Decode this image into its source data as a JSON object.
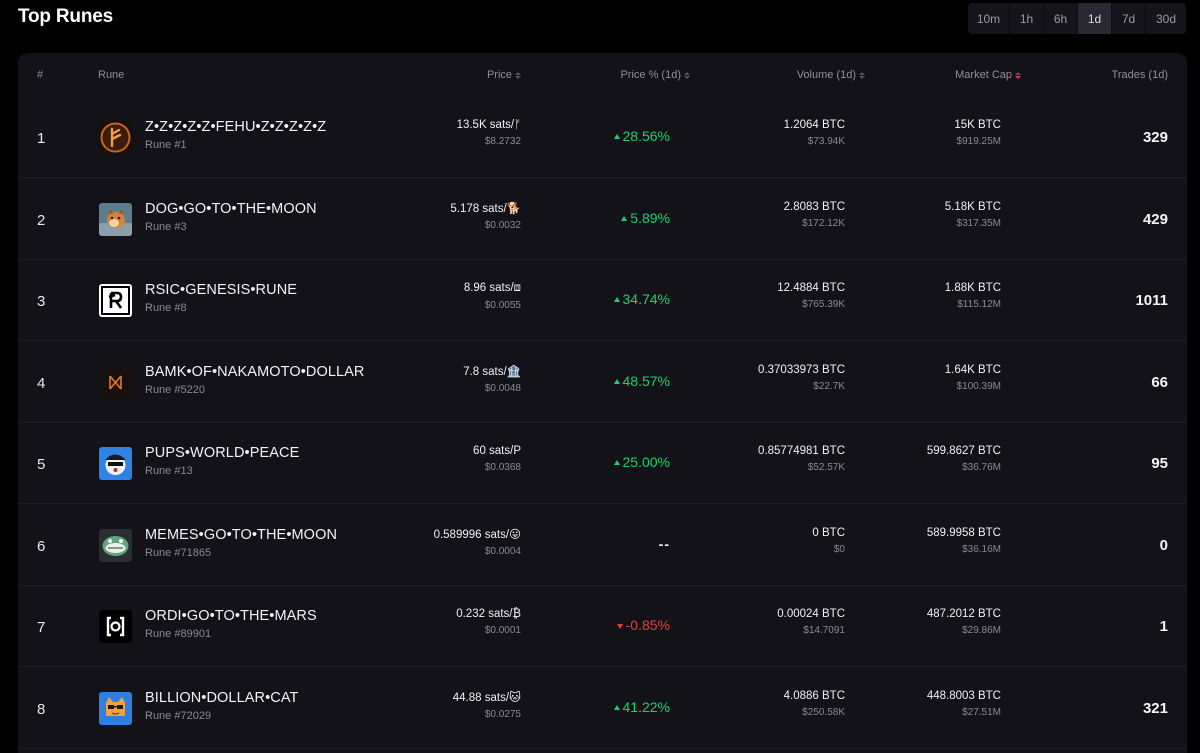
{
  "header": {
    "title": "Top Runes",
    "periods": [
      "10m",
      "1h",
      "6h",
      "1d",
      "7d",
      "30d"
    ],
    "active_period": "1d"
  },
  "columns": {
    "rank": "#",
    "rune": "Rune",
    "price": "Price",
    "price_pct": "Price % (1d)",
    "volume": "Volume (1d)",
    "market_cap": "Market Cap",
    "trades": "Trades (1d)"
  },
  "colors": {
    "positive": "#1fcf67",
    "negative": "#f03a3a",
    "sort_active": "#ff2a5c"
  },
  "rows": [
    {
      "rank": "1",
      "icon": "fehu-rune-icon",
      "name": "Z•Z•Z•Z•Z•FEHU•Z•Z•Z•Z•Z",
      "number": "Rune #1",
      "price_sats": "13.5K sats/ᚠ",
      "price_usd": "$8.2732",
      "pct": "28.56%",
      "dir": "up",
      "volume_btc": "1.2064 BTC",
      "volume_usd": "$73.94K",
      "cap_btc": "15K BTC",
      "cap_usd": "$919.25M",
      "trades": "329"
    },
    {
      "rank": "2",
      "icon": "dog-icon",
      "name": "DOG•GO•TO•THE•MOON",
      "number": "Rune #3",
      "price_sats": "5.178 sats/🐕",
      "price_usd": "$0.0032",
      "pct": "5.89%",
      "dir": "up",
      "volume_btc": "2.8083 BTC",
      "volume_usd": "$172.12K",
      "cap_btc": "5.18K BTC",
      "cap_usd": "$317.35M",
      "trades": "429"
    },
    {
      "rank": "3",
      "icon": "rsic-icon",
      "name": "RSIC•GENESIS•RUNE",
      "number": "Rune #8",
      "price_sats": "8.96 sats/⧈",
      "price_usd": "$0.0055",
      "pct": "34.74%",
      "dir": "up",
      "volume_btc": "12.4884 BTC",
      "volume_usd": "$765.39K",
      "cap_btc": "1.88K BTC",
      "cap_usd": "$115.12M",
      "trades": "1011"
    },
    {
      "rank": "4",
      "icon": "bamk-icon",
      "name": "BAMK•OF•NAKAMOTO•DOLLAR",
      "number": "Rune #5220",
      "price_sats": "7.8 sats/🏦",
      "price_usd": "$0.0048",
      "pct": "48.57%",
      "dir": "up",
      "volume_btc": "0.37033973 BTC",
      "volume_usd": "$22.7K",
      "cap_btc": "1.64K BTC",
      "cap_usd": "$100.39M",
      "trades": "66"
    },
    {
      "rank": "5",
      "icon": "pups-icon",
      "name": "PUPS•WORLD•PEACE",
      "number": "Rune #13",
      "price_sats": "60 sats/P",
      "price_usd": "$0.0368",
      "pct": "25.00%",
      "dir": "up",
      "volume_btc": "0.85774981 BTC",
      "volume_usd": "$52.57K",
      "cap_btc": "599.8627 BTC",
      "cap_usd": "$36.76M",
      "trades": "95"
    },
    {
      "rank": "6",
      "icon": "memes-icon",
      "name": "MEMES•GO•TO•THE•MOON",
      "number": "Rune #71865",
      "price_sats": "0.589996 sats/😛",
      "price_usd": "$0.0004",
      "pct": "--",
      "dir": "flat",
      "volume_btc": "0 BTC",
      "volume_usd": "$0",
      "cap_btc": "589.9958 BTC",
      "cap_usd": "$36.16M",
      "trades": "0"
    },
    {
      "rank": "7",
      "icon": "ordi-icon",
      "name": "ORDI•GO•TO•THE•MARS",
      "number": "Rune #89901",
      "price_sats": "0.232 sats/₿",
      "price_usd": "$0.0001",
      "pct": "-0.85%",
      "dir": "down",
      "volume_btc": "0.00024 BTC",
      "volume_usd": "$14.7091",
      "cap_btc": "487.2012 BTC",
      "cap_usd": "$29.86M",
      "trades": "1"
    },
    {
      "rank": "8",
      "icon": "cat-icon",
      "name": "BILLION•DOLLAR•CAT",
      "number": "Rune #72029",
      "price_sats": "44.88 sats/🐱",
      "price_usd": "$0.0275",
      "pct": "41.22%",
      "dir": "up",
      "volume_btc": "4.0886 BTC",
      "volume_usd": "$250.58K",
      "cap_btc": "448.8003 BTC",
      "cap_usd": "$27.51M",
      "trades": "321"
    }
  ]
}
